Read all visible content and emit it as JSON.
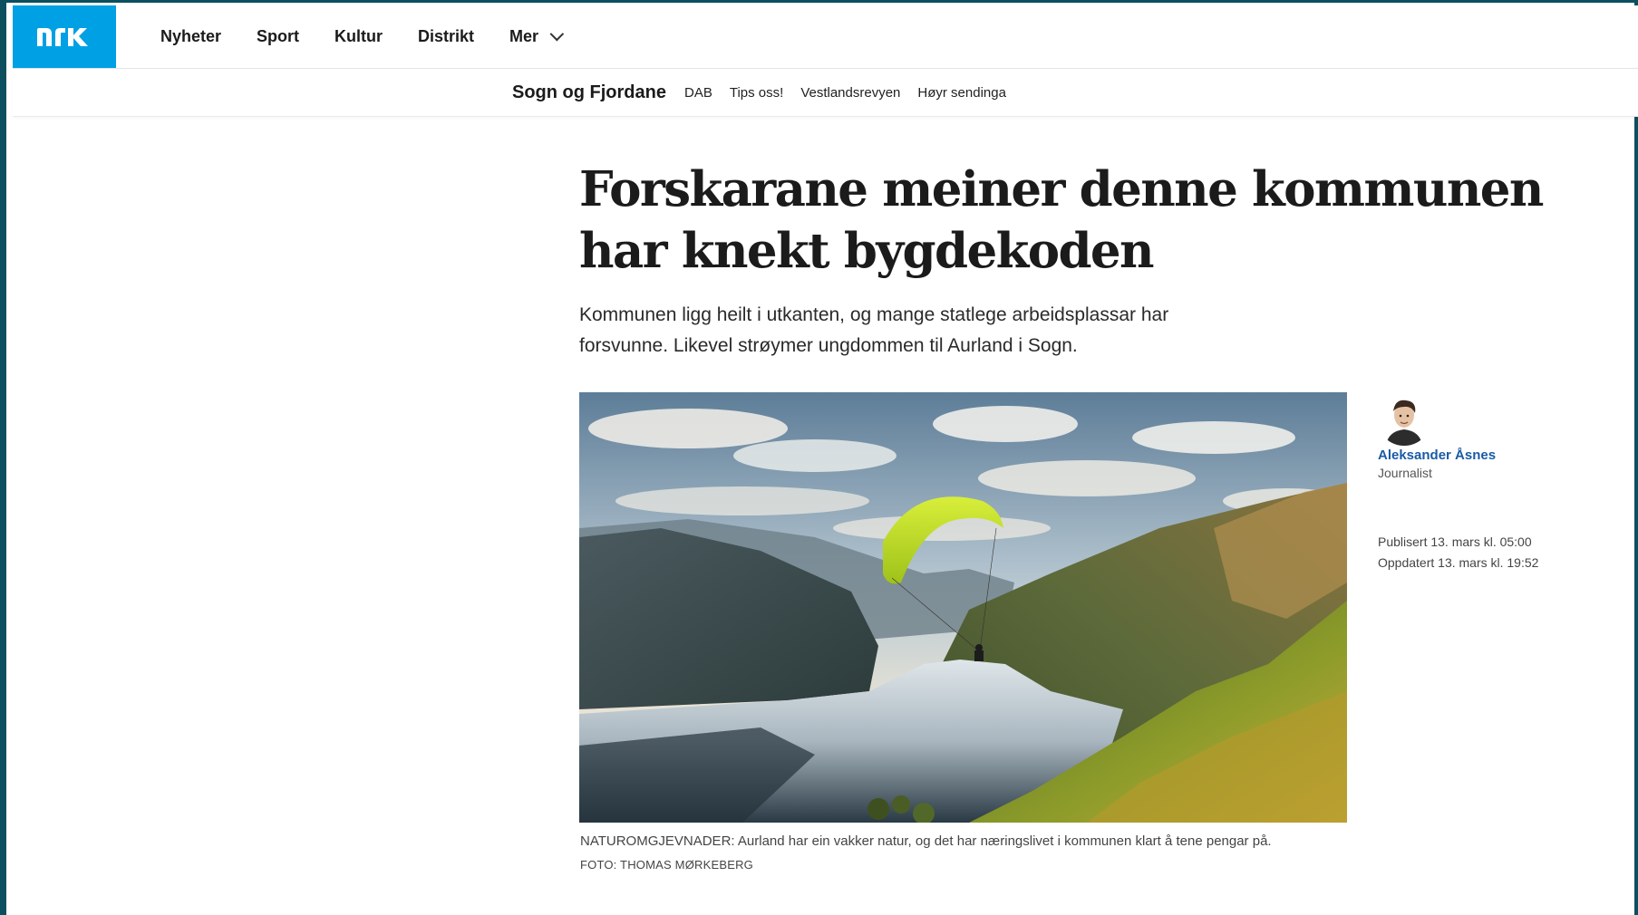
{
  "brand": {
    "logo_text": "NRK",
    "logo_bg": "#00a0e4"
  },
  "topnav": {
    "items": [
      {
        "label": "Nyheter"
      },
      {
        "label": "Sport"
      },
      {
        "label": "Kultur"
      },
      {
        "label": "Distrikt"
      },
      {
        "label": "Mer",
        "icon": "chevron-down-icon"
      }
    ]
  },
  "subnav": {
    "title": "Sogn og Fjordane",
    "links": [
      "DAB",
      "Tips oss!",
      "Vestlandsrevyen",
      "Høyr sendinga"
    ]
  },
  "article": {
    "headline": "Forskarane meiner denne kommunen har knekt bygdekoden",
    "lead": "Kommunen ligg heilt i utkanten, og mange statlege arbeidsplassar har forsvunne. Likevel strøymer ungdommen til Aurland i Sogn.",
    "image_caption": "NATUROMGJEVNADER: Aurland har ein vakker natur, og det har næringslivet i kommunen klart å tene pengar på.",
    "image_credit": "FOTO: THOMAS MØRKEBERG"
  },
  "byline": {
    "author_name": "Aleksander Åsnes",
    "author_role": "Journalist",
    "published": "Publisert 13. mars kl. 05:00",
    "updated": "Oppdatert 13. mars kl. 19:52",
    "link_color": "#1a5aa8"
  }
}
